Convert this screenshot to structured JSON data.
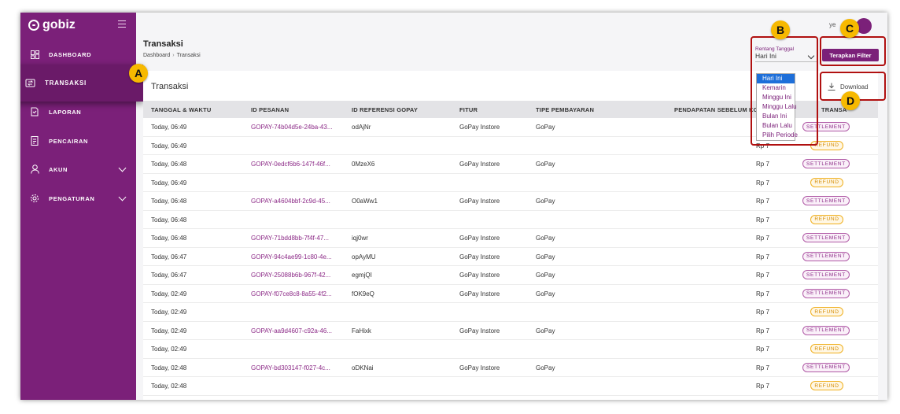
{
  "sidebar": {
    "brand": "gobiz",
    "items": [
      {
        "label": "DASHBOARD",
        "icon": "dashboard-icon"
      },
      {
        "label": "TRANSAKSI",
        "icon": "transaction-icon"
      },
      {
        "label": "LAPORAN",
        "icon": "report-icon"
      },
      {
        "label": "PENCAIRAN",
        "icon": "disbursement-icon"
      },
      {
        "label": "AKUN",
        "icon": "user-icon"
      },
      {
        "label": "PENGATURAN",
        "icon": "gear-icon"
      }
    ]
  },
  "header": {
    "title": "Transaksi",
    "breadcrumb": [
      "Dashboard",
      "Transaksi"
    ],
    "user": "ye"
  },
  "filter": {
    "label": "Rentang Tanggal",
    "selected": "Hari Ini",
    "options": [
      "Hari Ini",
      "Kemarin",
      "Minggu Ini",
      "Minggu Lalu",
      "Bulan Ini",
      "Bulan Lalu",
      "Pilih Periode"
    ],
    "apply_label": "Terapkan Filter"
  },
  "card": {
    "title": "Transaksi",
    "download_label": "Download"
  },
  "table": {
    "columns": [
      "TANGGAL & WAKTU",
      "ID PESANAN",
      "ID REFERENSI GOPAY",
      "FITUR",
      "TIPE PEMBAYARAN",
      "PENDAPATAN SEBELUM KO",
      "TRANSA"
    ],
    "rows": [
      {
        "time": "Today, 06:49",
        "order": "GOPAY-74b04d5e-24ba-43...",
        "ref": "odAjNr",
        "feature": "GoPay Instore",
        "payment": "GoPay",
        "amount": "",
        "status": "SETTLEMENT"
      },
      {
        "time": "Today, 06:49",
        "order": "",
        "ref": "",
        "feature": "",
        "payment": "",
        "amount": "Rp 7",
        "status": "REFUND"
      },
      {
        "time": "Today, 06:48",
        "order": "GOPAY-0edcf6b6-147f-46f...",
        "ref": "0MzeX6",
        "feature": "GoPay Instore",
        "payment": "GoPay",
        "amount": "Rp 7",
        "status": "SETTLEMENT"
      },
      {
        "time": "Today, 06:49",
        "order": "",
        "ref": "",
        "feature": "",
        "payment": "",
        "amount": "Rp 7",
        "status": "REFUND"
      },
      {
        "time": "Today, 06:48",
        "order": "GOPAY-a4604bbf-2c9d-45...",
        "ref": "O0aWw1",
        "feature": "GoPay Instore",
        "payment": "GoPay",
        "amount": "Rp 7",
        "status": "SETTLEMENT"
      },
      {
        "time": "Today, 06:48",
        "order": "",
        "ref": "",
        "feature": "",
        "payment": "",
        "amount": "Rp 7",
        "status": "REFUND"
      },
      {
        "time": "Today, 06:48",
        "order": "GOPAY-71bdd8bb-7f4f-47...",
        "ref": "iqj0wr",
        "feature": "GoPay Instore",
        "payment": "GoPay",
        "amount": "Rp 7",
        "status": "SETTLEMENT"
      },
      {
        "time": "Today, 06:47",
        "order": "GOPAY-94c4ae99-1c80-4e...",
        "ref": "opAyMU",
        "feature": "GoPay Instore",
        "payment": "GoPay",
        "amount": "Rp 7",
        "status": "SETTLEMENT"
      },
      {
        "time": "Today, 06:47",
        "order": "GOPAY-25088b6b-967f-42...",
        "ref": "egmjQI",
        "feature": "GoPay Instore",
        "payment": "GoPay",
        "amount": "Rp 7",
        "status": "SETTLEMENT"
      },
      {
        "time": "Today, 02:49",
        "order": "GOPAY-f07ce8c8-8a55-4f2...",
        "ref": "fOK9eQ",
        "feature": "GoPay Instore",
        "payment": "GoPay",
        "amount": "Rp 7",
        "status": "SETTLEMENT"
      },
      {
        "time": "Today, 02:49",
        "order": "",
        "ref": "",
        "feature": "",
        "payment": "",
        "amount": "Rp 7",
        "status": "REFUND"
      },
      {
        "time": "Today, 02:49",
        "order": "GOPAY-aa9d4607-c92a-46...",
        "ref": "FaHixk",
        "feature": "GoPay Instore",
        "payment": "GoPay",
        "amount": "Rp 7",
        "status": "SETTLEMENT"
      },
      {
        "time": "Today, 02:49",
        "order": "",
        "ref": "",
        "feature": "",
        "payment": "",
        "amount": "Rp 7",
        "status": "REFUND"
      },
      {
        "time": "Today, 02:48",
        "order": "GOPAY-bd303147-f027-4c...",
        "ref": "oDKNai",
        "feature": "GoPay Instore",
        "payment": "GoPay",
        "amount": "Rp 7",
        "status": "SETTLEMENT"
      },
      {
        "time": "Today, 02:48",
        "order": "",
        "ref": "",
        "feature": "",
        "payment": "",
        "amount": "Rp 7",
        "status": "REFUND"
      }
    ]
  },
  "annotations": {
    "a": "A",
    "b": "B",
    "c": "C",
    "d": "D"
  },
  "colors": {
    "brand": "#7b2079",
    "highlight": "#b01010",
    "marker": "#f7b900"
  }
}
